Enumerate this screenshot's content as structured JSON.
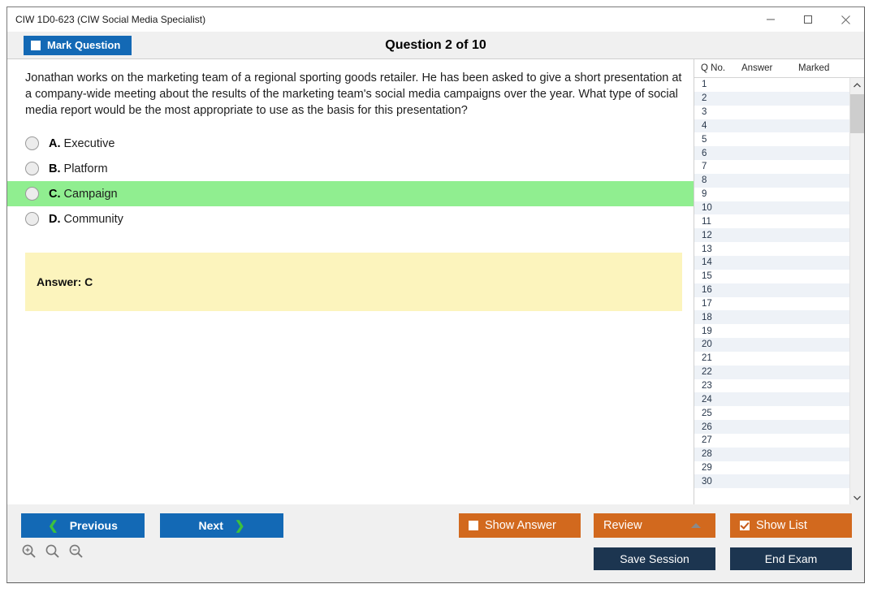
{
  "window": {
    "title": "CIW 1D0-623 (CIW Social Media Specialist)",
    "minimize_label": "Minimize",
    "maximize_label": "Maximize",
    "close_label": "Close"
  },
  "header": {
    "mark_question_label": "Mark Question",
    "mark_question_checked": false,
    "title": "Question 2 of 10"
  },
  "question": {
    "text": "Jonathan works on the marketing team of a regional sporting goods retailer. He has been asked to give a short presentation at a company-wide meeting about the results of the marketing team's social media campaigns over the year. What type of social media report would be the most appropriate to use as the basis for this presentation?",
    "options": [
      {
        "letter": "A.",
        "text": "Executive",
        "correct": false,
        "selected": false
      },
      {
        "letter": "B.",
        "text": "Platform",
        "correct": false,
        "selected": false
      },
      {
        "letter": "C.",
        "text": "Campaign",
        "correct": true,
        "selected": false
      },
      {
        "letter": "D.",
        "text": "Community",
        "correct": false,
        "selected": false
      }
    ],
    "answer_label": "Answer: C"
  },
  "question_list": {
    "columns": [
      "Q No.",
      "Answer",
      "Marked"
    ],
    "rows": [
      {
        "no": "1",
        "answer": "",
        "marked": ""
      },
      {
        "no": "2",
        "answer": "",
        "marked": ""
      },
      {
        "no": "3",
        "answer": "",
        "marked": ""
      },
      {
        "no": "4",
        "answer": "",
        "marked": ""
      },
      {
        "no": "5",
        "answer": "",
        "marked": ""
      },
      {
        "no": "6",
        "answer": "",
        "marked": ""
      },
      {
        "no": "7",
        "answer": "",
        "marked": ""
      },
      {
        "no": "8",
        "answer": "",
        "marked": ""
      },
      {
        "no": "9",
        "answer": "",
        "marked": ""
      },
      {
        "no": "10",
        "answer": "",
        "marked": ""
      },
      {
        "no": "11",
        "answer": "",
        "marked": ""
      },
      {
        "no": "12",
        "answer": "",
        "marked": ""
      },
      {
        "no": "13",
        "answer": "",
        "marked": ""
      },
      {
        "no": "14",
        "answer": "",
        "marked": ""
      },
      {
        "no": "15",
        "answer": "",
        "marked": ""
      },
      {
        "no": "16",
        "answer": "",
        "marked": ""
      },
      {
        "no": "17",
        "answer": "",
        "marked": ""
      },
      {
        "no": "18",
        "answer": "",
        "marked": ""
      },
      {
        "no": "19",
        "answer": "",
        "marked": ""
      },
      {
        "no": "20",
        "answer": "",
        "marked": ""
      },
      {
        "no": "21",
        "answer": "",
        "marked": ""
      },
      {
        "no": "22",
        "answer": "",
        "marked": ""
      },
      {
        "no": "23",
        "answer": "",
        "marked": ""
      },
      {
        "no": "24",
        "answer": "",
        "marked": ""
      },
      {
        "no": "25",
        "answer": "",
        "marked": ""
      },
      {
        "no": "26",
        "answer": "",
        "marked": ""
      },
      {
        "no": "27",
        "answer": "",
        "marked": ""
      },
      {
        "no": "28",
        "answer": "",
        "marked": ""
      },
      {
        "no": "29",
        "answer": "",
        "marked": ""
      },
      {
        "no": "30",
        "answer": "",
        "marked": ""
      }
    ]
  },
  "footer": {
    "previous_label": "Previous",
    "next_label": "Next",
    "show_answer_label": "Show Answer",
    "show_answer_checked": false,
    "review_label": "Review",
    "show_list_label": "Show List",
    "show_list_checked": true,
    "save_session_label": "Save Session",
    "end_exam_label": "End Exam",
    "zoom_in_label": "Zoom In",
    "zoom_reset_label": "Zoom Reset",
    "zoom_out_label": "Zoom Out"
  },
  "colors": {
    "accent_blue": "#1369b5",
    "accent_orange": "#d2691e",
    "navy": "#1c3550",
    "correct_green": "#90ee90",
    "answer_yellow": "#fcf4bd",
    "chevron_green": "#3dc13d"
  }
}
